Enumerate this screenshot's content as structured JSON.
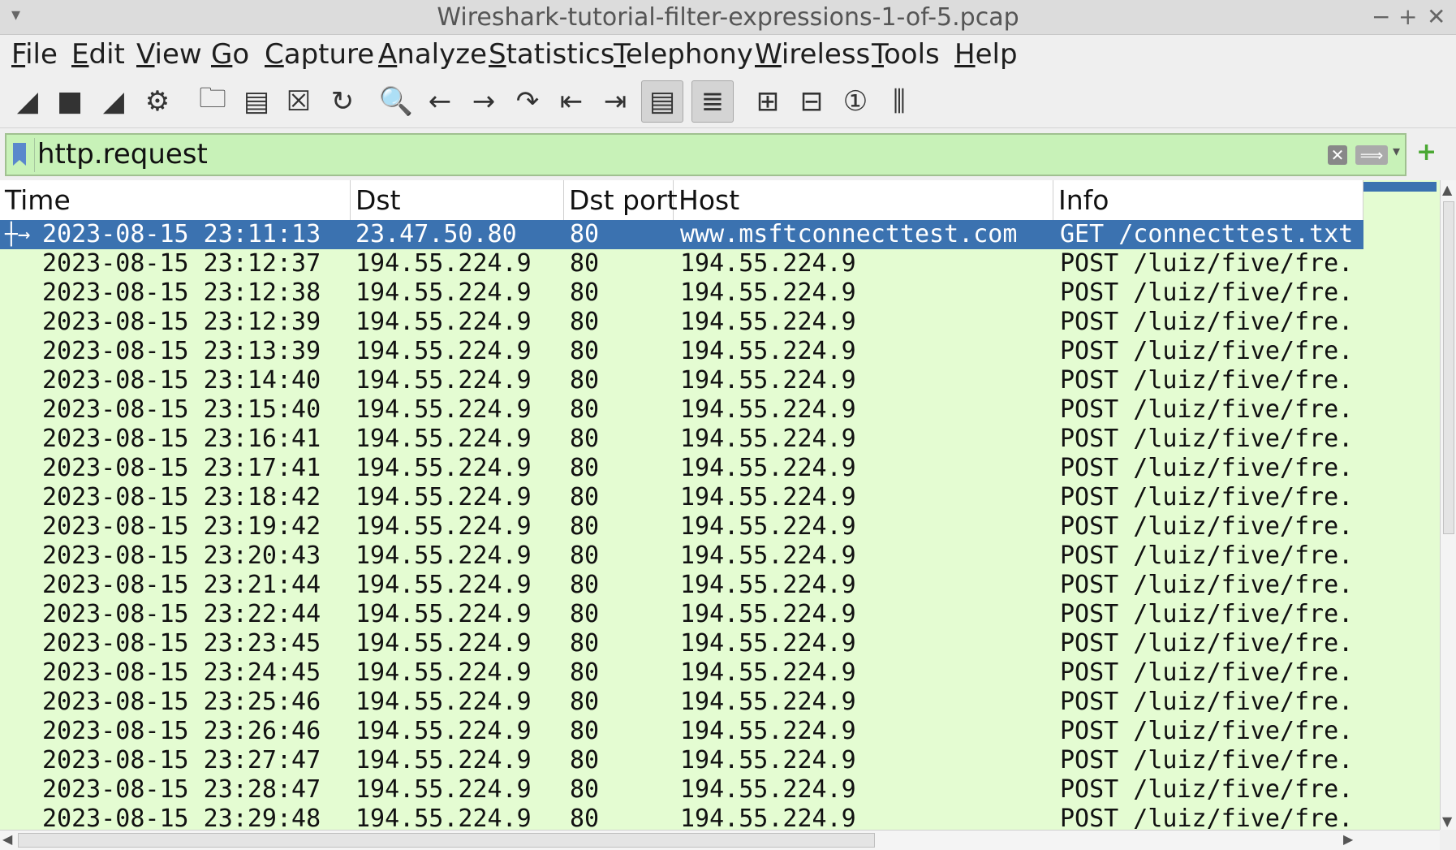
{
  "window": {
    "title": "Wireshark-tutorial-filter-expressions-1-of-5.pcap",
    "controls": {
      "minimize": "−",
      "maximize": "+",
      "close": "✕"
    }
  },
  "menu": [
    "File",
    "Edit",
    "View",
    "Go",
    "Capture",
    "Analyze",
    "Statistics",
    "Telephony",
    "Wireless",
    "Tools",
    "Help"
  ],
  "toolbar": [
    {
      "icon": "shark-fin-start-icon",
      "glyph": "◢"
    },
    {
      "icon": "stop-capture-icon",
      "glyph": "■"
    },
    {
      "icon": "restart-capture-icon",
      "glyph": "◢"
    },
    {
      "icon": "capture-options-icon",
      "glyph": "⚙"
    },
    {
      "icon": "open-file-icon",
      "glyph": "🗀"
    },
    {
      "icon": "save-file-icon",
      "glyph": "▤"
    },
    {
      "icon": "close-file-icon",
      "glyph": "☒"
    },
    {
      "icon": "reload-icon",
      "glyph": "↻"
    },
    {
      "icon": "find-packet-icon",
      "glyph": "🔍"
    },
    {
      "icon": "go-back-icon",
      "glyph": "←"
    },
    {
      "icon": "go-forward-icon",
      "glyph": "→"
    },
    {
      "icon": "go-to-packet-icon",
      "glyph": "↷"
    },
    {
      "icon": "go-first-icon",
      "glyph": "⇤"
    },
    {
      "icon": "go-last-icon",
      "glyph": "⇥"
    },
    {
      "icon": "autoscroll-icon",
      "glyph": "▤",
      "pressed": true
    },
    {
      "icon": "colorize-icon",
      "glyph": "≣",
      "pressed": true
    },
    {
      "icon": "zoom-in-icon",
      "glyph": "⊞"
    },
    {
      "icon": "zoom-out-icon",
      "glyph": "⊟"
    },
    {
      "icon": "normal-size-icon",
      "glyph": "①"
    },
    {
      "icon": "resize-columns-icon",
      "glyph": "⫼"
    }
  ],
  "filter": {
    "value": "http.request",
    "clear_glyph": "✕",
    "apply_glyph": "⟹",
    "dropdown_glyph": "▾",
    "add_glyph": "+"
  },
  "columns": [
    "Time",
    "Dst",
    "Dst port",
    "Host",
    "Info"
  ],
  "rows": [
    {
      "time": "2023-08-15 23:11:13",
      "dst": "23.47.50.80",
      "port": "80",
      "host": "www.msftconnecttest.com",
      "info": "GET /connecttest.txt",
      "selected": true
    },
    {
      "time": "2023-08-15 23:12:37",
      "dst": "194.55.224.9",
      "port": "80",
      "host": "194.55.224.9",
      "info": "POST /luiz/five/fre."
    },
    {
      "time": "2023-08-15 23:12:38",
      "dst": "194.55.224.9",
      "port": "80",
      "host": "194.55.224.9",
      "info": "POST /luiz/five/fre."
    },
    {
      "time": "2023-08-15 23:12:39",
      "dst": "194.55.224.9",
      "port": "80",
      "host": "194.55.224.9",
      "info": "POST /luiz/five/fre."
    },
    {
      "time": "2023-08-15 23:13:39",
      "dst": "194.55.224.9",
      "port": "80",
      "host": "194.55.224.9",
      "info": "POST /luiz/five/fre."
    },
    {
      "time": "2023-08-15 23:14:40",
      "dst": "194.55.224.9",
      "port": "80",
      "host": "194.55.224.9",
      "info": "POST /luiz/five/fre."
    },
    {
      "time": "2023-08-15 23:15:40",
      "dst": "194.55.224.9",
      "port": "80",
      "host": "194.55.224.9",
      "info": "POST /luiz/five/fre."
    },
    {
      "time": "2023-08-15 23:16:41",
      "dst": "194.55.224.9",
      "port": "80",
      "host": "194.55.224.9",
      "info": "POST /luiz/five/fre."
    },
    {
      "time": "2023-08-15 23:17:41",
      "dst": "194.55.224.9",
      "port": "80",
      "host": "194.55.224.9",
      "info": "POST /luiz/five/fre."
    },
    {
      "time": "2023-08-15 23:18:42",
      "dst": "194.55.224.9",
      "port": "80",
      "host": "194.55.224.9",
      "info": "POST /luiz/five/fre."
    },
    {
      "time": "2023-08-15 23:19:42",
      "dst": "194.55.224.9",
      "port": "80",
      "host": "194.55.224.9",
      "info": "POST /luiz/five/fre."
    },
    {
      "time": "2023-08-15 23:20:43",
      "dst": "194.55.224.9",
      "port": "80",
      "host": "194.55.224.9",
      "info": "POST /luiz/five/fre."
    },
    {
      "time": "2023-08-15 23:21:44",
      "dst": "194.55.224.9",
      "port": "80",
      "host": "194.55.224.9",
      "info": "POST /luiz/five/fre."
    },
    {
      "time": "2023-08-15 23:22:44",
      "dst": "194.55.224.9",
      "port": "80",
      "host": "194.55.224.9",
      "info": "POST /luiz/five/fre."
    },
    {
      "time": "2023-08-15 23:23:45",
      "dst": "194.55.224.9",
      "port": "80",
      "host": "194.55.224.9",
      "info": "POST /luiz/five/fre."
    },
    {
      "time": "2023-08-15 23:24:45",
      "dst": "194.55.224.9",
      "port": "80",
      "host": "194.55.224.9",
      "info": "POST /luiz/five/fre."
    },
    {
      "time": "2023-08-15 23:25:46",
      "dst": "194.55.224.9",
      "port": "80",
      "host": "194.55.224.9",
      "info": "POST /luiz/five/fre."
    },
    {
      "time": "2023-08-15 23:26:46",
      "dst": "194.55.224.9",
      "port": "80",
      "host": "194.55.224.9",
      "info": "POST /luiz/five/fre."
    },
    {
      "time": "2023-08-15 23:27:47",
      "dst": "194.55.224.9",
      "port": "80",
      "host": "194.55.224.9",
      "info": "POST /luiz/five/fre."
    },
    {
      "time": "2023-08-15 23:28:47",
      "dst": "194.55.224.9",
      "port": "80",
      "host": "194.55.224.9",
      "info": "POST /luiz/five/fre."
    },
    {
      "time": "2023-08-15 23:29:48",
      "dst": "194.55.224.9",
      "port": "80",
      "host": "194.55.224.9",
      "info": "POST /luiz/five/fre."
    }
  ],
  "colors": {
    "row_bg": "#e4fcd2",
    "selected_bg": "#3b72b0",
    "filter_bg": "#c8f2b8"
  }
}
